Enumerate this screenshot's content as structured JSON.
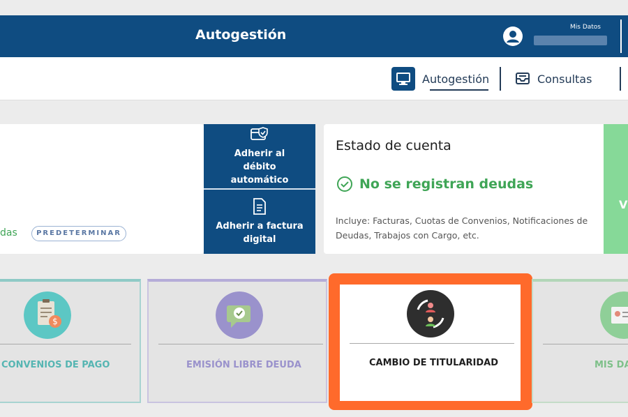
{
  "header": {
    "title": "Autogestión",
    "user_label": "Mis Datos"
  },
  "subnav": {
    "items": [
      {
        "label": "Autogestión",
        "icon": "monitor-icon",
        "active": true
      },
      {
        "label": "Consultas",
        "icon": "inbox-icon",
        "active": false
      }
    ]
  },
  "left_card": {
    "deudas_partial": "das",
    "predeterminar_label": "PREDETERMINAR"
  },
  "actions": {
    "debito_label": "Adherir al débito automático",
    "factura_label": "Adherir a factura digital"
  },
  "estado": {
    "title": "Estado de cuenta",
    "status": "No se registran deudas",
    "detail": "Incluye: Facturas, Cuotas de Convenios, Notificaciones de Deudas, Trabajos con Cargo, etc.",
    "side_letter": "V"
  },
  "tiles": {
    "convenios": "CONVENIOS DE PAGO",
    "libre_deuda": "EMISIÓN LIBRE DEUDA",
    "cambio": "CAMBIO DE TITULARIDAD",
    "mis_datos": "MIS DA"
  },
  "colors": {
    "primary": "#0f4c81",
    "success": "#3fa556",
    "highlight": "#ff6a2b"
  }
}
